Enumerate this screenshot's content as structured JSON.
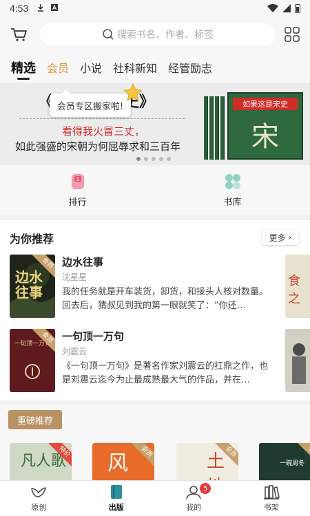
{
  "status_bar": {
    "time": "4:53"
  },
  "search": {
    "placeholder": "搜索书名、作者、标签"
  },
  "tabs": [
    {
      "label": "精选"
    },
    {
      "label": "会员"
    },
    {
      "label": "小说"
    },
    {
      "label": "社科新知"
    },
    {
      "label": "经管励志"
    }
  ],
  "banner": {
    "title_left": "《",
    "title_right": "史》",
    "tooltip": "会员专区搬家啦!",
    "line_red": "看得我火冒三丈，",
    "line_black": "如此强盛的宋朝为何屈辱求和三百年",
    "book_title": "如果这是宋史",
    "book_char": "宋"
  },
  "quick": [
    {
      "label": "排行",
      "icon": "ranking-icon"
    },
    {
      "label": "书库",
      "icon": "library-icon"
    }
  ],
  "recommend": {
    "heading": "为你推荐",
    "more_label": "更多",
    "books": [
      {
        "title": "边水往事",
        "author": "沈星星",
        "desc": "我的任务就是开车装货，卸货，和接头人核对数量。回去后，猜叔见到我的第一眼就笑了：“你还…",
        "ribbon": "会员",
        "cover_text": "边水往事"
      },
      {
        "title": "一句顶一万句",
        "author": "刘震云",
        "desc": "《一句顶一万句》是著名作家刘震云的扛鼎之作，也是刘震云迄今为止最成熟最大气的作品，并在…",
        "ribbon": "会员",
        "cover_text": "一句顶一万句"
      }
    ],
    "peek_text": "食之"
  },
  "featured": {
    "tag": "重磅推荐",
    "covers": [
      {
        "ribbon": "特价",
        "text": "凡人歌"
      },
      {
        "ribbon": "会员",
        "text": "风"
      },
      {
        "ribbon": "会员",
        "text": "土地"
      },
      {
        "ribbon": "会员",
        "text": "一碗周冬"
      }
    ]
  },
  "bottom_nav": [
    {
      "label": "原创",
      "icon": "bird-icon"
    },
    {
      "label": "出版",
      "icon": "book-icon"
    },
    {
      "label": "我的",
      "icon": "profile-icon",
      "badge": "5"
    },
    {
      "label": "书架",
      "icon": "bookshelf-icon"
    }
  ],
  "colors": {
    "vip_accent": "#e8932b",
    "featured_tag": "#b99264",
    "badge": "#e23a3a"
  }
}
